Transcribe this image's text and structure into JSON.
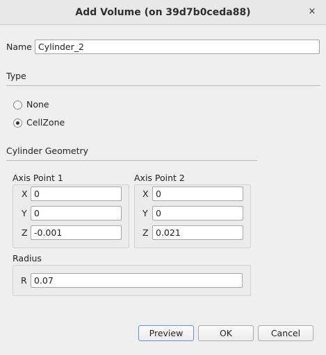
{
  "window": {
    "title": "Add Volume (on 39d7b0ceda88)",
    "close_glyph": "×"
  },
  "name": {
    "label": "Name",
    "value": "Cylinder_2"
  },
  "type": {
    "heading": "Type",
    "options": [
      {
        "label": "None",
        "checked": false
      },
      {
        "label": "CellZone",
        "checked": true
      }
    ]
  },
  "geometry": {
    "heading": "Cylinder Geometry",
    "axis1": {
      "label": "Axis Point 1",
      "x_label": "X",
      "x": "0",
      "y_label": "Y",
      "y": "0",
      "z_label": "Z",
      "z": "-0.001"
    },
    "axis2": {
      "label": "Axis Point 2",
      "x_label": "X",
      "x": "0",
      "y_label": "Y",
      "y": "0",
      "z_label": "Z",
      "z": "0.021"
    },
    "radius": {
      "label": "Radius",
      "r_label": "R",
      "r": "0.07"
    }
  },
  "buttons": {
    "preview": "Preview",
    "ok": "OK",
    "cancel": "Cancel"
  }
}
